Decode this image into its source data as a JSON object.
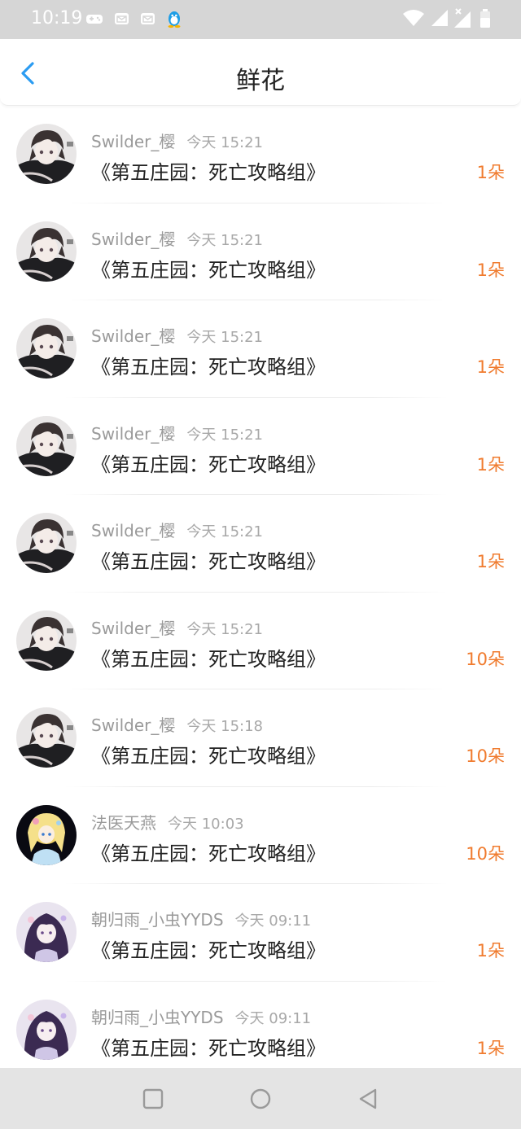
{
  "status_bar": {
    "time": "10:19",
    "icons": [
      "gamepad-icon",
      "mail-icon",
      "mail-icon",
      "qq-penguin-icon",
      "wifi-icon",
      "signal-icon",
      "signal-no-sim-icon",
      "battery-icon"
    ]
  },
  "header": {
    "back_icon": "chevron-left-icon",
    "title": "鲜花"
  },
  "list": [
    {
      "user": "Swilder_樱",
      "time": "今天 15:21",
      "book": "《第五庄园：死亡攻略组》",
      "count": "1朵",
      "avatar": "dark-hair-boy"
    },
    {
      "user": "Swilder_樱",
      "time": "今天 15:21",
      "book": "《第五庄园：死亡攻略组》",
      "count": "1朵",
      "avatar": "dark-hair-boy"
    },
    {
      "user": "Swilder_樱",
      "time": "今天 15:21",
      "book": "《第五庄园：死亡攻略组》",
      "count": "1朵",
      "avatar": "dark-hair-boy"
    },
    {
      "user": "Swilder_樱",
      "time": "今天 15:21",
      "book": "《第五庄园：死亡攻略组》",
      "count": "1朵",
      "avatar": "dark-hair-boy"
    },
    {
      "user": "Swilder_樱",
      "time": "今天 15:21",
      "book": "《第五庄园：死亡攻略组》",
      "count": "1朵",
      "avatar": "dark-hair-boy"
    },
    {
      "user": "Swilder_樱",
      "time": "今天 15:21",
      "book": "《第五庄园：死亡攻略组》",
      "count": "10朵",
      "avatar": "dark-hair-boy"
    },
    {
      "user": "Swilder_樱",
      "time": "今天 15:18",
      "book": "《第五庄园：死亡攻略组》",
      "count": "10朵",
      "avatar": "dark-hair-boy"
    },
    {
      "user": "法医天燕",
      "time": "今天 10:03",
      "book": "《第五庄园：死亡攻略组》",
      "count": "10朵",
      "avatar": "blonde-girl"
    },
    {
      "user": "朝归雨_小虫YYDS",
      "time": "今天 09:11",
      "book": "《第五庄园：死亡攻略组》",
      "count": "1朵",
      "avatar": "purple-hair-girl"
    },
    {
      "user": "朝归雨_小虫YYDS",
      "time": "今天 09:11",
      "book": "《第五庄园：死亡攻略组》",
      "count": "1朵",
      "avatar": "purple-hair-girl"
    }
  ],
  "nav_bar": {
    "icons": [
      "recents-square-icon",
      "home-circle-icon",
      "back-triangle-icon"
    ]
  },
  "colors": {
    "accent_blue": "#2b9cf2",
    "count_orange": "#f07b2e",
    "status_bar_bg": "#d6d6d6",
    "nav_bar_bg": "#e4e4e4"
  }
}
